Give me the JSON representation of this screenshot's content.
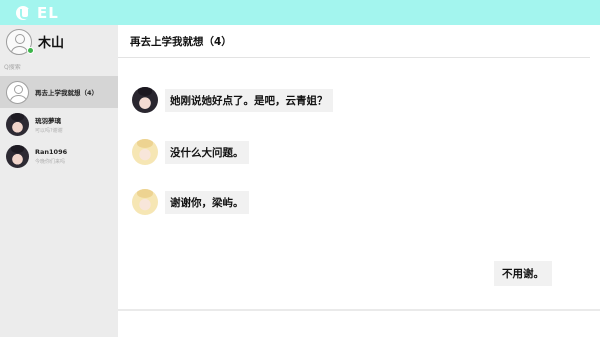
{
  "app": {
    "title": "EL",
    "logo_icon": "el-logo-icon",
    "accent_color": "#a3f5ee"
  },
  "profile": {
    "name": "木山",
    "status_color": "#3cb44a"
  },
  "search": {
    "placeholder": "Q搜索"
  },
  "contacts": [
    {
      "name": "再去上学我就想（4）",
      "preview": "",
      "avatar": "default-avatar-icon",
      "active": true
    },
    {
      "name": "琉羽夢璃",
      "preview": "可以吗?谢谢",
      "avatar": "dark-hair-avatar",
      "active": false
    },
    {
      "name": "Ran1096",
      "preview": "今晚你们来吗",
      "avatar": "dark-hair-avatar",
      "active": false
    }
  ],
  "chat": {
    "title": "再去上学我就想（4）",
    "messages": [
      {
        "side": "left",
        "avatar": "dark-hair-avatar",
        "text": "她刚说她好点了。是吧，云青姐？"
      },
      {
        "side": "left",
        "avatar": "blond-hair-avatar",
        "text": "没什么大问题。"
      },
      {
        "side": "left",
        "avatar": "blond-hair-avatar",
        "text": "谢谢你，梁屿。"
      },
      {
        "side": "right",
        "text": "不用谢。"
      }
    ]
  }
}
